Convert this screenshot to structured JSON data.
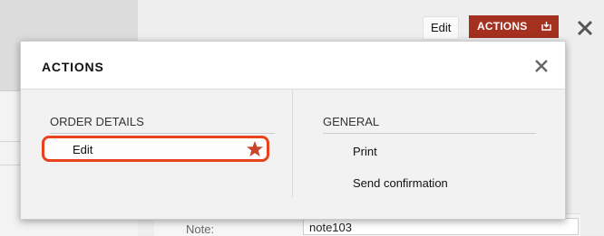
{
  "topbar": {
    "edit_label": "Edit",
    "actions_label": "ACTIONS",
    "actions_color": "#a4301f"
  },
  "background": {
    "note_label": "Note:",
    "note_value": "note103"
  },
  "dialog": {
    "title": "ACTIONS",
    "columns": [
      {
        "title": "ORDER DETAILS",
        "items": [
          {
            "label": "Edit",
            "favorite": true,
            "highlighted": true
          }
        ]
      },
      {
        "title": "GENERAL",
        "items": [
          {
            "label": "Print"
          },
          {
            "label": "Send confirmation"
          }
        ]
      }
    ],
    "highlight_color": "#e8431c",
    "star_color": "#c8442c"
  }
}
